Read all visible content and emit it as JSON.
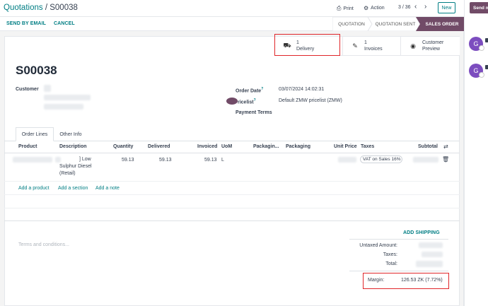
{
  "breadcrumb": {
    "parent": "Quotations",
    "separator": "/",
    "current": "S00038"
  },
  "topbar": {
    "print_label": "Print",
    "action_label": "Action",
    "pager": "3 / 36",
    "new_label": "New"
  },
  "actions": {
    "send_email": "SEND BY EMAIL",
    "cancel": "CANCEL"
  },
  "stages": [
    {
      "label": "QUOTATION",
      "active": false
    },
    {
      "label": "QUOTATION SENT",
      "active": false
    },
    {
      "label": "SALES ORDER",
      "active": true
    }
  ],
  "smart_buttons": {
    "delivery": {
      "count": "1",
      "label": "Delivery"
    },
    "invoices": {
      "count": "1",
      "label": "Invoices"
    },
    "preview": {
      "line1": "Customer",
      "line2": "Preview"
    }
  },
  "order": {
    "name": "S00038",
    "customer_label": "Customer",
    "order_date_label": "Order Date",
    "order_date_value": "03/07/2024 14:02:31",
    "pricelist_label": "ricelist",
    "pricelist_value": "Default ZMW pricelist (ZMW)",
    "payment_terms_label": "Payment Terms"
  },
  "tabs": {
    "order_lines": "Order Lines",
    "other_info": "Other Info"
  },
  "columns": {
    "product": "Product",
    "description": "Description",
    "quantity": "Quantity",
    "delivered": "Delivered",
    "invoiced": "Invoiced",
    "uom": "UoM",
    "packaging_qty": "Packagin...",
    "packaging": "Packaging",
    "unit_price": "Unit Price",
    "taxes": "Taxes",
    "subtotal": "Subtotal"
  },
  "line": {
    "description_1": "] Low",
    "description_2": "Sulphur Diesel",
    "description_3": "(Retail)",
    "quantity": "59.13",
    "delivered": "59.13",
    "invoiced": "59.13",
    "uom": "L",
    "tax": "VAT on Sales 16%"
  },
  "line_actions": {
    "add_product": "Add a product",
    "add_section": "Add a section",
    "add_note": "Add a note"
  },
  "footer": {
    "terms_placeholder": "Terms and conditions...",
    "add_shipping": "ADD SHIPPING",
    "untaxed_label": "Untaxed Amount:",
    "taxes_label": "Taxes:",
    "total_label": "Total:",
    "margin_label": "Margin:",
    "margin_value": "126.53 ZK (7.72%)"
  },
  "chatter": {
    "send_label": "Send m",
    "avatar_letter": "G"
  },
  "colors": {
    "brand": "#017e84",
    "stage_active": "#714b67",
    "highlight": "#e0262a",
    "avatar": "#7c4dbf"
  }
}
